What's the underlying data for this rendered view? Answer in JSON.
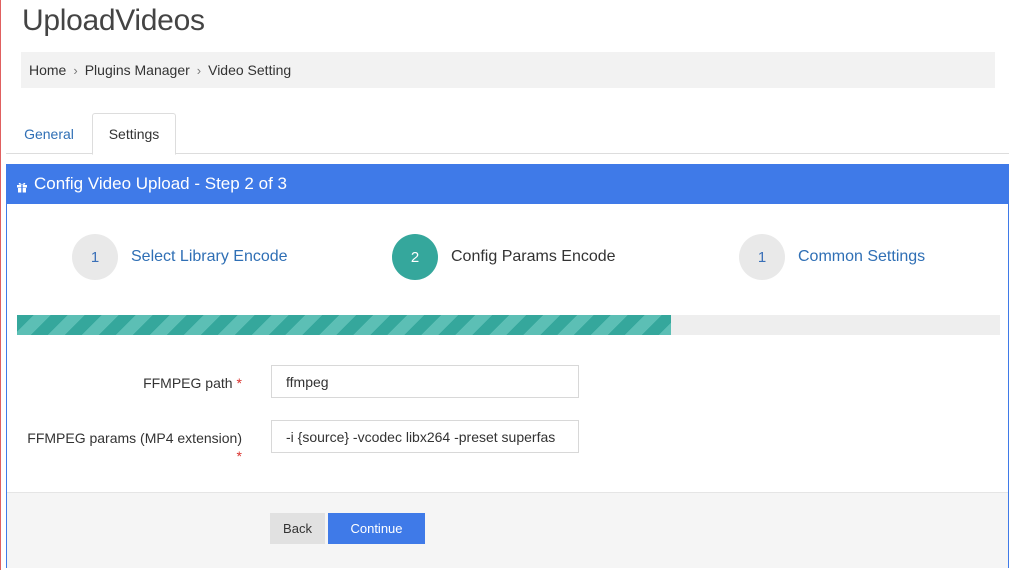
{
  "page": {
    "title": "UploadVideos"
  },
  "breadcrumb": {
    "items": [
      "Home",
      "Plugins Manager",
      "Video Setting"
    ],
    "separator": "›"
  },
  "tabs": [
    {
      "label": "General",
      "active": false
    },
    {
      "label": "Settings",
      "active": true
    }
  ],
  "panel": {
    "header_icon": "gift-icon",
    "title": "Config Video Upload - Step 2 of 3"
  },
  "steps": [
    {
      "number": "1",
      "label": "Select Library Encode",
      "active": false
    },
    {
      "number": "2",
      "label": "Config Params Encode",
      "active": true
    },
    {
      "number": "1",
      "label": "Common Settings",
      "active": false
    }
  ],
  "progress": {
    "percent": 66.5,
    "color": "#35a79c"
  },
  "form": {
    "ffmpeg_path": {
      "label": "FFMPEG path",
      "required_mark": "*",
      "value": "ffmpeg"
    },
    "ffmpeg_params": {
      "label": "FFMPEG params (MP4 extension)",
      "required_mark": "*",
      "value": "-i {source} -vcodec libx264 -preset superfas"
    }
  },
  "buttons": {
    "back": "Back",
    "continue": "Continue"
  },
  "colors": {
    "primary": "#3f7ae8",
    "success": "#35a79c",
    "link": "#2f6fb5",
    "required": "#d9302c"
  }
}
